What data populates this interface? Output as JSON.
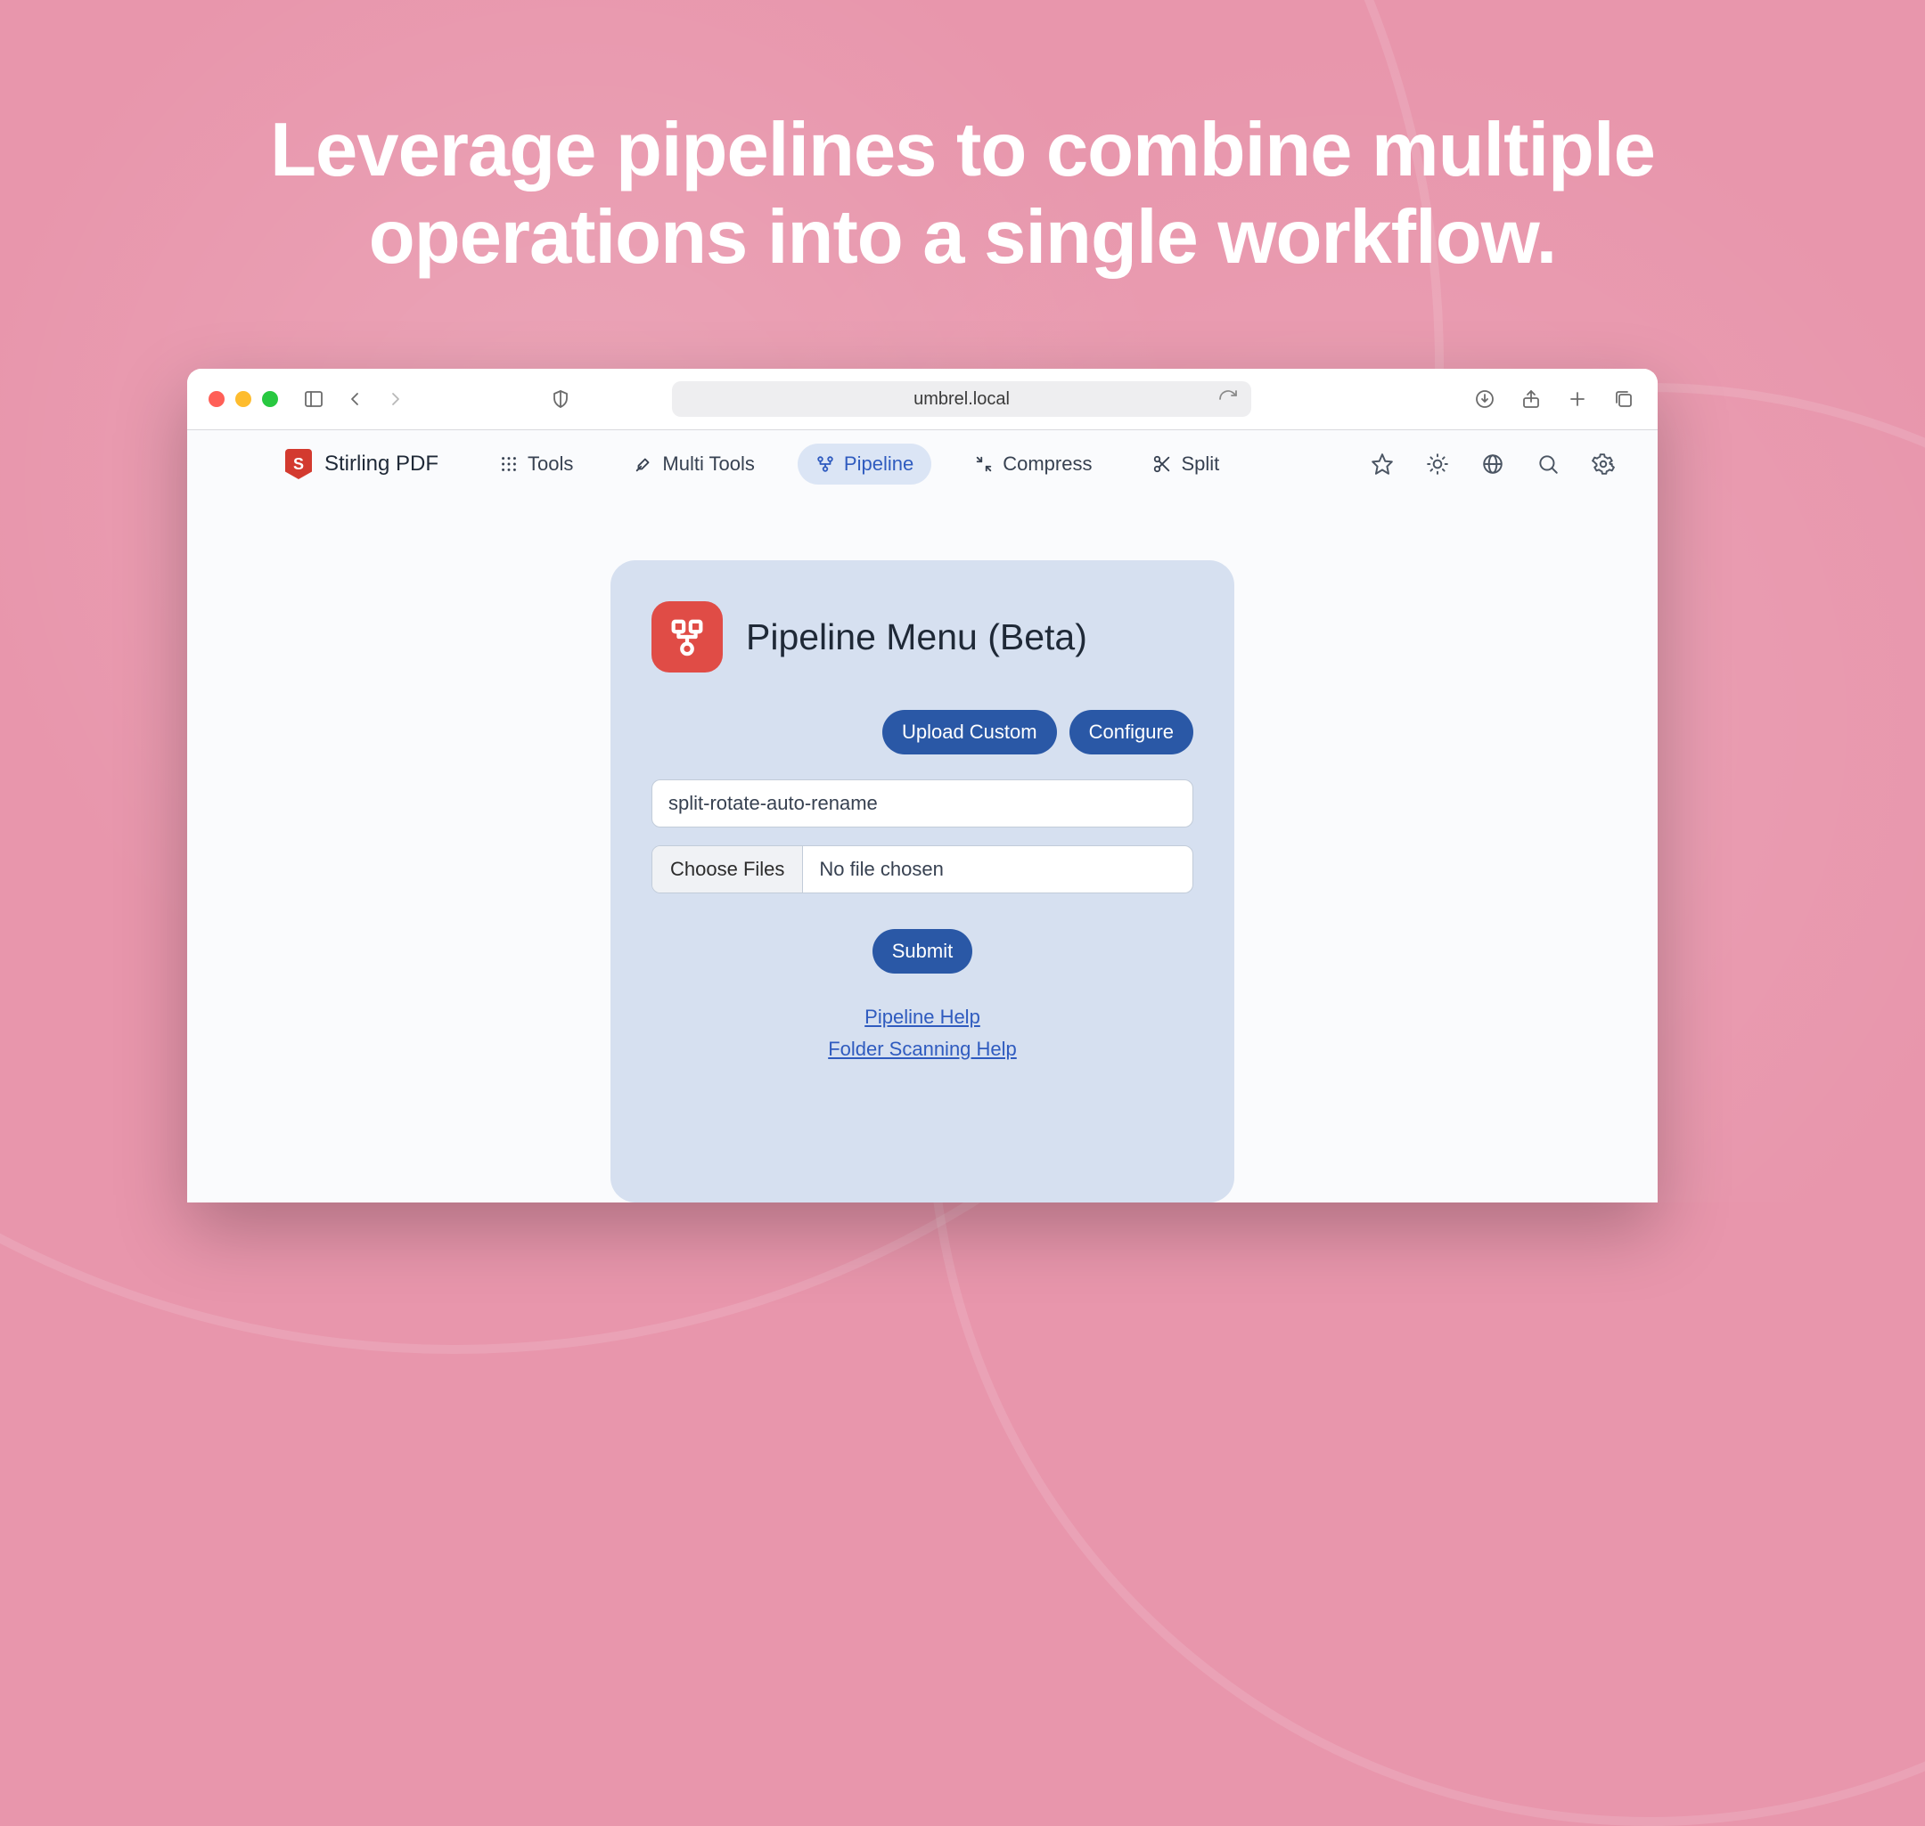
{
  "headline": "Leverage pipelines to combine multiple operations into a single workflow.",
  "browser": {
    "url": "umbrel.local"
  },
  "app": {
    "brand_name": "Stirling PDF",
    "brand_letter": "S",
    "nav": {
      "tools": "Tools",
      "multi_tools": "Multi Tools",
      "pipeline": "Pipeline",
      "compress": "Compress",
      "split": "Split"
    }
  },
  "card": {
    "title": "Pipeline Menu (Beta)",
    "upload_custom": "Upload Custom",
    "configure": "Configure",
    "pipeline_name": "split-rotate-auto-rename",
    "choose_files": "Choose Files",
    "no_file": "No file chosen",
    "submit": "Submit",
    "help_pipeline": "Pipeline Help",
    "help_folder": "Folder Scanning Help"
  }
}
